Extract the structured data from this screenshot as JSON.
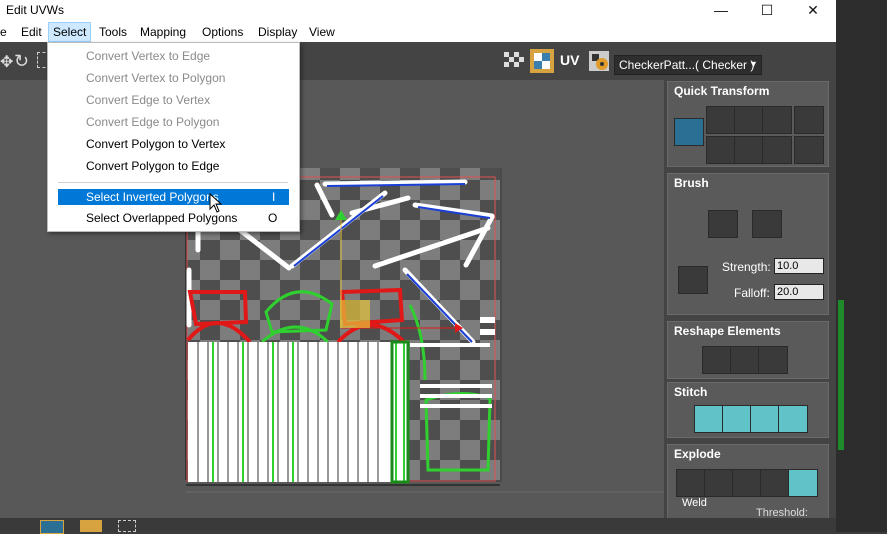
{
  "window": {
    "title": "Edit UVWs",
    "minimize": "—",
    "maximize": "☐",
    "close": "✕"
  },
  "menu": [
    "e",
    "Edit",
    "Select",
    "Tools",
    "Mapping",
    "Options",
    "Display",
    "View"
  ],
  "toolbar": {
    "uv_label": "UV",
    "texture_dropdown": "CheckerPatt...( Checker )"
  },
  "select_menu": {
    "items": [
      {
        "label": "Convert Vertex to Edge",
        "enabled": false
      },
      {
        "label": "Convert Vertex to Polygon",
        "enabled": false
      },
      {
        "label": "Convert Edge to Vertex",
        "enabled": false
      },
      {
        "label": "Convert Edge to Polygon",
        "enabled": false
      },
      {
        "label": "Convert Polygon to Vertex",
        "enabled": true
      },
      {
        "label": "Convert Polygon to Edge",
        "enabled": true
      },
      {
        "label": "Select Inverted Polygons",
        "enabled": true,
        "shortcut": "I",
        "highlighted": true
      },
      {
        "label": "Select Overlapped Polygons",
        "enabled": true,
        "shortcut": "O"
      }
    ]
  },
  "panel": {
    "quick_transform": "Quick Transform",
    "brush": "Brush",
    "strength_label": "Strength:",
    "strength_value": "10.0",
    "falloff_label": "Falloff:",
    "falloff_value": "20.0",
    "reshape": "Reshape Elements",
    "stitch": "Stitch",
    "explode": "Explode",
    "weld": "Weld",
    "threshold": "Threshold:"
  },
  "colors": {
    "accent": "#0078d7",
    "teal": "#5fc3c8",
    "uv_edge": "#ffffff",
    "uv_select": "#00ff00",
    "uv_seam": "#ff0000"
  }
}
